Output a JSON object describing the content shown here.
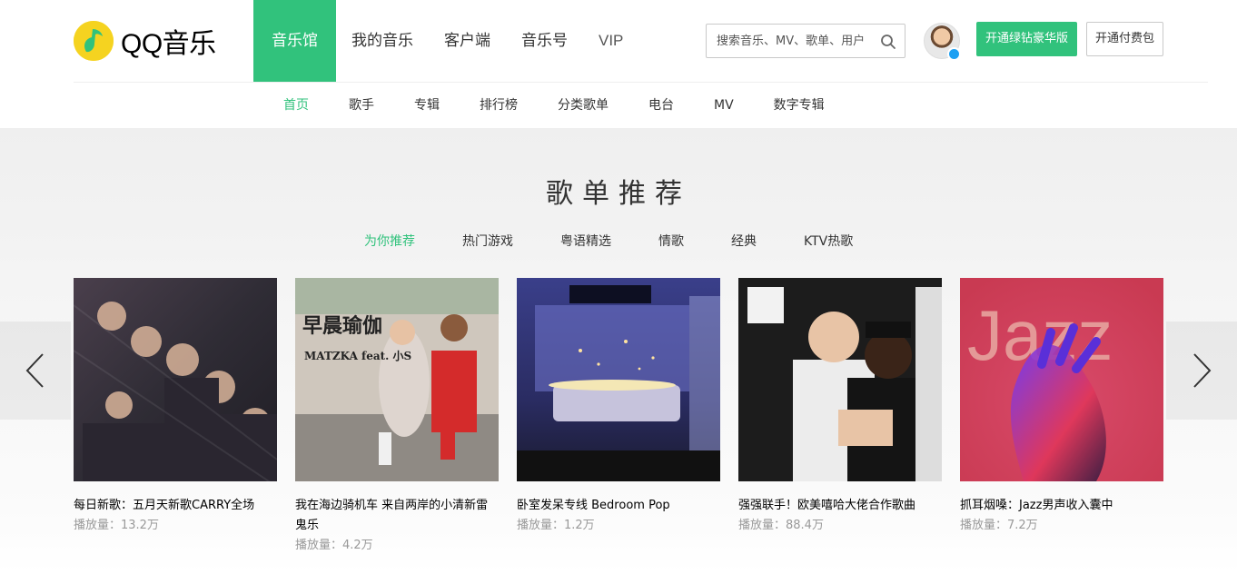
{
  "brand": {
    "logo_text": "QQ音乐",
    "accent": "#31c27c",
    "logo_color": "#f5d320"
  },
  "main_nav": [
    {
      "label": "音乐馆",
      "active": true
    },
    {
      "label": "我的音乐",
      "active": false
    },
    {
      "label": "客户端",
      "active": false
    },
    {
      "label": "音乐号",
      "active": false
    },
    {
      "label": "VIP",
      "active": false
    }
  ],
  "search": {
    "placeholder": "搜索音乐、MV、歌单、用户"
  },
  "header_buttons": {
    "green_vip": "开通绿钻豪华版",
    "paid_pack": "开通付费包"
  },
  "sub_nav": [
    {
      "label": "首页",
      "active": true
    },
    {
      "label": "歌手",
      "active": false
    },
    {
      "label": "专辑",
      "active": false
    },
    {
      "label": "排行榜",
      "active": false
    },
    {
      "label": "分类歌单",
      "active": false
    },
    {
      "label": "电台",
      "active": false
    },
    {
      "label": "MV",
      "active": false
    },
    {
      "label": "数字专辑",
      "active": false
    }
  ],
  "section": {
    "title": "歌单推荐",
    "tabs": [
      {
        "label": "为你推荐",
        "active": true
      },
      {
        "label": "热门游戏",
        "active": false
      },
      {
        "label": "粤语精选",
        "active": false
      },
      {
        "label": "情歌",
        "active": false
      },
      {
        "label": "经典",
        "active": false
      },
      {
        "label": "KTV热歌",
        "active": false
      }
    ]
  },
  "playlists": [
    {
      "title": "每日新歌：五月天新歌CARRY全场",
      "plays": "播放量：13.2万"
    },
    {
      "title": "我在海边骑机车 来自两岸的小清新雷鬼乐",
      "plays": "播放量：4.2万",
      "cover_text": "早晨瑜伽",
      "cover_subtext": "MATZKA feat. 小S"
    },
    {
      "title": "卧室发呆专线 Bedroom Pop",
      "plays": "播放量：1.2万"
    },
    {
      "title": "强强联手！欧美嘻哈大佬合作歌曲",
      "plays": "播放量：88.4万"
    },
    {
      "title": "抓耳烟嗓：Jazz男声收入囊中",
      "plays": "播放量：7.2万",
      "cover_text": "Jazz"
    }
  ]
}
